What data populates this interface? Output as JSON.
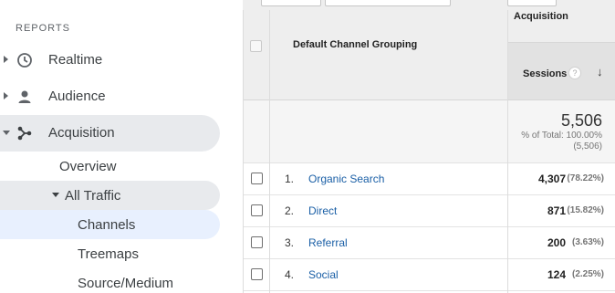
{
  "sidebar": {
    "section_title": "REPORTS",
    "items": [
      {
        "label": "Realtime",
        "icon": "clock-icon"
      },
      {
        "label": "Audience",
        "icon": "person-icon"
      },
      {
        "label": "Acquisition",
        "icon": "acquisition-icon"
      }
    ],
    "sub_items": {
      "overview": "Overview",
      "all_traffic": "All Traffic",
      "channels": "Channels",
      "treemaps": "Treemaps",
      "source_medium": "Source/Medium"
    }
  },
  "table": {
    "dimension_header": "Default Channel Grouping",
    "group_header": "Acquisition",
    "metric_header": "Sessions",
    "help_glyph": "?",
    "sort_glyph": "↓",
    "totals": {
      "value": "5,506",
      "line1": "% of Total: 100.00%",
      "line2": "(5,506)"
    },
    "rows": [
      {
        "index": "1.",
        "channel": "Organic Search",
        "sessions": "4,307",
        "pct": "(78.22%)"
      },
      {
        "index": "2.",
        "channel": "Direct",
        "sessions": "871",
        "pct": "(15.82%)"
      },
      {
        "index": "3.",
        "channel": "Referral",
        "sessions": "200",
        "pct": "(3.63%)"
      },
      {
        "index": "4.",
        "channel": "Social",
        "sessions": "124",
        "pct": "(2.25%)"
      }
    ]
  },
  "colors": {
    "link": "#1a5fa6",
    "active_nav": "#e8f0fe",
    "hover_nav": "#e8eaed",
    "header_bg": "#eeeeee"
  }
}
